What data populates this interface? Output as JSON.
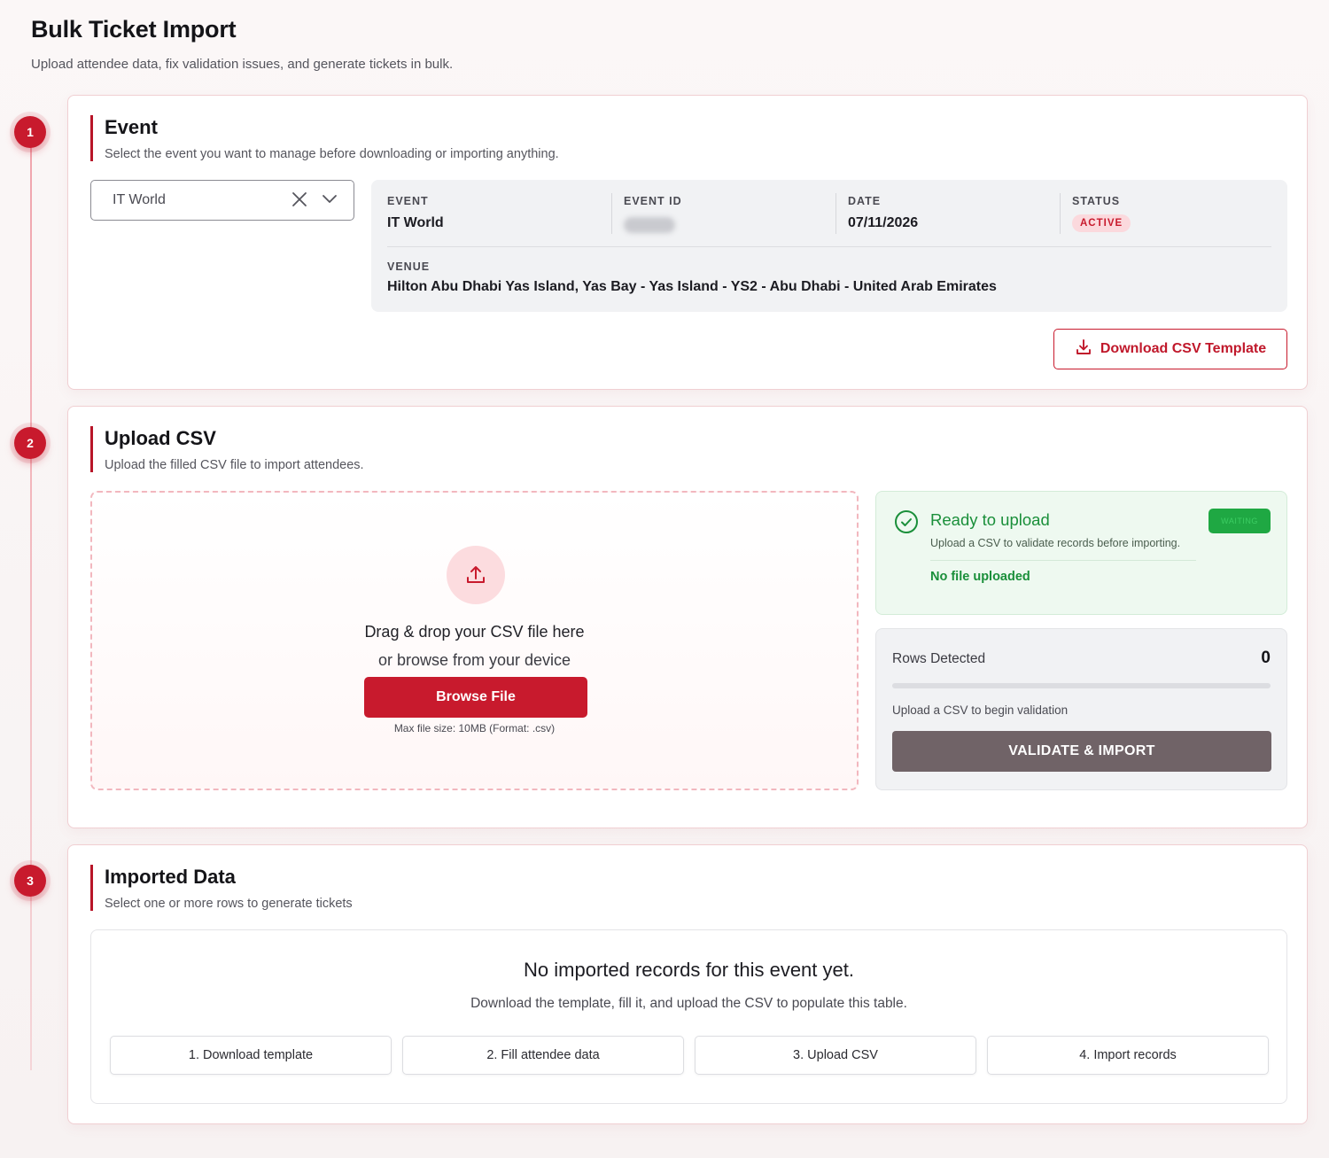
{
  "header": {
    "title": "Bulk Ticket Import",
    "subtitle": "Upload attendee data, fix validation issues, and generate tickets in bulk."
  },
  "steps": [
    "1",
    "2",
    "3"
  ],
  "event_section": {
    "title": "Event",
    "description": "Select the event you want to manage before downloading or importing anything.",
    "selected_event": "IT World",
    "info": {
      "event_label": "EVENT",
      "event_value": "IT World",
      "event_id_label": "EVENT ID",
      "date_label": "DATE",
      "date_value": "07/11/2026",
      "status_label": "STATUS",
      "status_value": "ACTIVE",
      "venue_label": "VENUE",
      "venue_value": "Hilton Abu Dhabi Yas Island, Yas Bay - Yas Island - YS2 - Abu Dhabi - United Arab Emirates"
    },
    "download_button": "Download CSV Template"
  },
  "upload_section": {
    "title": "Upload CSV",
    "description": "Upload the filled CSV file to import attendees.",
    "dropzone": {
      "line1": "Drag & drop your CSV file here",
      "line2": "or browse from your device",
      "browse_button": "Browse File",
      "hint": "Max file size: 10MB (Format: .csv)"
    },
    "ready": {
      "title": "Ready to upload",
      "description": "Upload a CSV to validate records before importing.",
      "badge": "WAITING",
      "file_status": "No file uploaded"
    },
    "rows": {
      "label": "Rows Detected",
      "count": "0",
      "progress": 0,
      "hint": "Upload a CSV to begin validation",
      "validate_button": "VALIDATE & IMPORT"
    }
  },
  "imported_section": {
    "title": "Imported Data",
    "description": "Select one or more rows to generate tickets",
    "empty_title": "No imported records for this event yet.",
    "empty_description": "Download the template, fill it, and upload the CSV to populate this table.",
    "step_chips": [
      "1. Download template",
      "2. Fill attendee data",
      "3. Upload CSV",
      "4. Import records"
    ]
  },
  "colors": {
    "accent": "#c81a2d",
    "success": "#1a8f3a",
    "validate_button": "#706367"
  }
}
